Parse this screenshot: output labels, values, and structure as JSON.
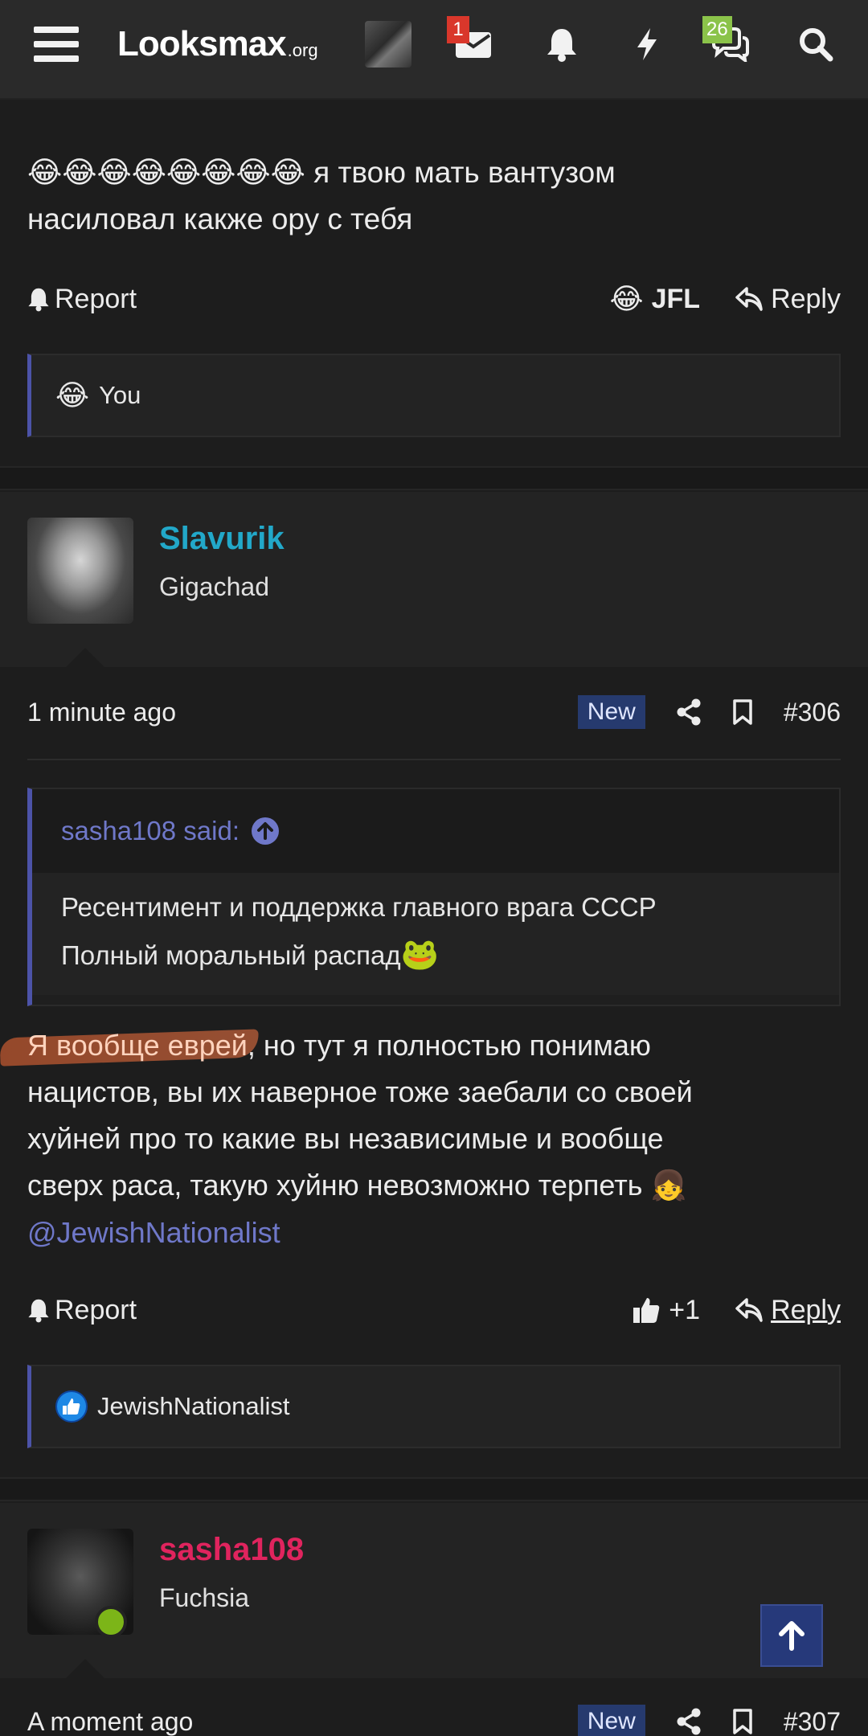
{
  "header": {
    "logo_main": "Looksmax",
    "logo_tld": ".org",
    "inbox_count": "1",
    "chats_count": "26"
  },
  "post_prev": {
    "emojis": "😂😂😂😂😂😂😂😂",
    "text_line1": " я твою мать вантузом",
    "text_line2": "насиловал какже ору с тебя",
    "report_label": "Report",
    "reaction_label": "JFL",
    "reply_label": "Reply",
    "reaction_by": "You"
  },
  "post_306": {
    "username": "Slavurik",
    "username_color": "#22a8c9",
    "user_title": "Gigachad",
    "time": "1 minute ago",
    "new_badge": "New",
    "number": "#306",
    "quote_author": "sasha108 said:",
    "quote_line1": "Ресентимент и поддержка главного врага СССР",
    "quote_line2": "Полный моральный распад",
    "body_highlight": "Я вообще еврей",
    "body_line1_rest": ", но тут я полностью понимаю",
    "body_line2": "нацистов, вы их наверное тоже заебали со своей",
    "body_line3": "хуйней про то какие вы независимые и вообще",
    "body_line4": "сверх раса, такую хуйню невозможно терпеть",
    "mention": "@JewishNationalist",
    "report_label": "Report",
    "like_count": "+1",
    "reply_label": "Reply",
    "reaction_by": "JewishNationalist"
  },
  "post_307": {
    "username": "sasha108",
    "username_color": "#e0245e",
    "user_title": "Fuchsia",
    "time": "A moment ago",
    "new_badge": "New",
    "number": "#307"
  },
  "colors": {
    "accent": "#4c53a8",
    "background": "#1d1d1d",
    "topbar": "#2a2a2a"
  }
}
